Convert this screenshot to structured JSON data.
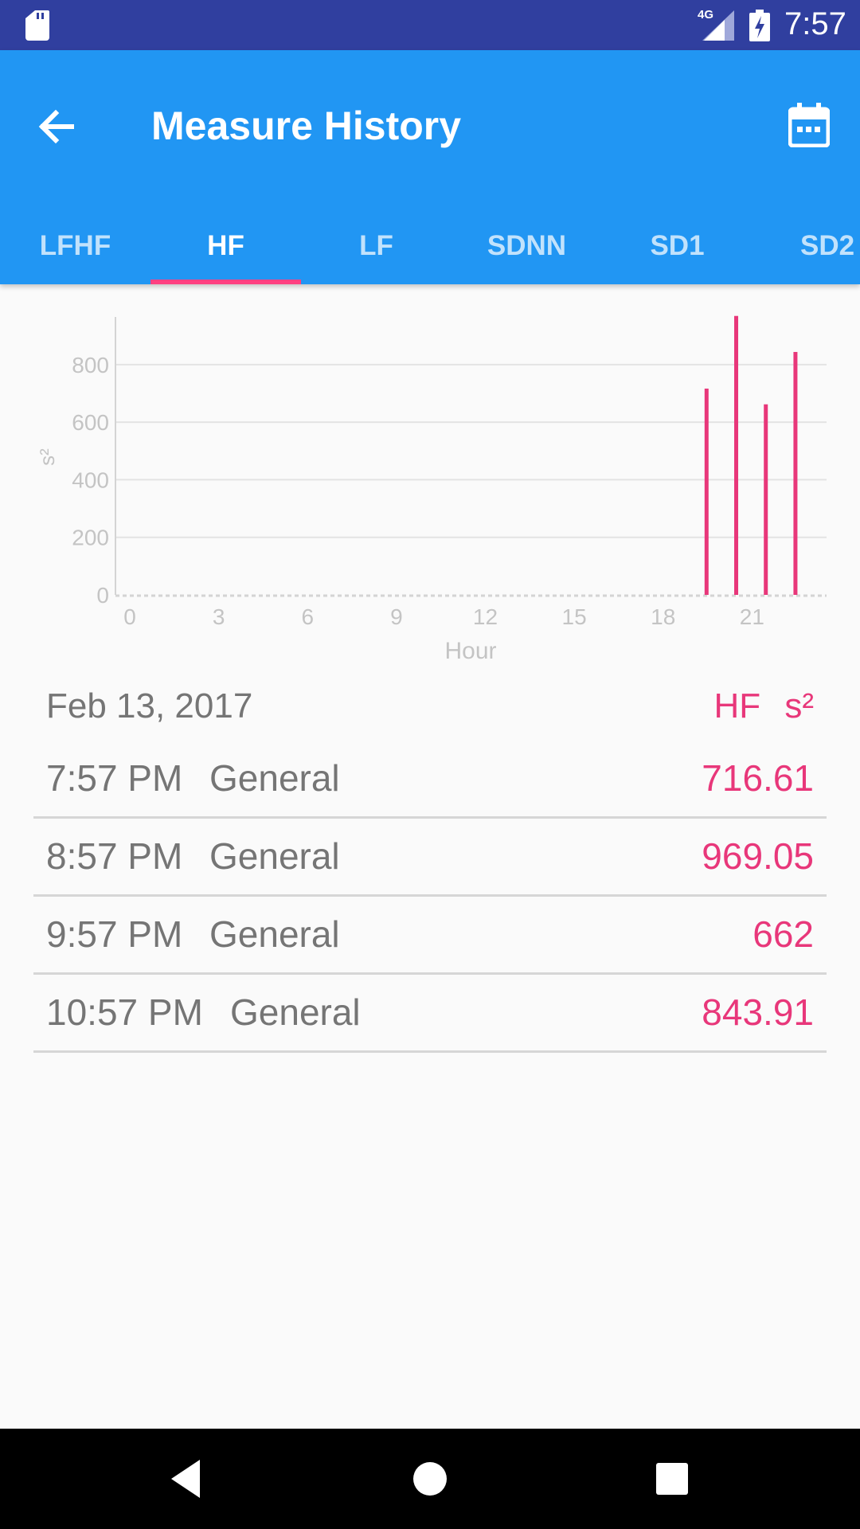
{
  "status_bar": {
    "time": "7:57",
    "network": "4G",
    "icons": [
      "sd-card-icon",
      "signal-icon",
      "battery-charging-icon"
    ]
  },
  "app_bar": {
    "title": "Measure History",
    "back_icon": "arrow-back-icon",
    "calendar_icon": "calendar-icon",
    "background": "#2196f3",
    "status_background": "#303f9f",
    "indicator_color": "#ff4081"
  },
  "tabs": [
    {
      "label": "LFHF",
      "active": false
    },
    {
      "label": "HF",
      "active": true
    },
    {
      "label": "LF",
      "active": false
    },
    {
      "label": "SDNN",
      "active": false
    },
    {
      "label": "SD1",
      "active": false
    },
    {
      "label": "SD2",
      "active": false
    }
  ],
  "chart_data": {
    "type": "bar",
    "ylabel": "s²",
    "xlabel": "Hour",
    "xlim": [
      0,
      24
    ],
    "ylim": [
      0,
      960
    ],
    "x_ticks": [
      0,
      3,
      6,
      9,
      12,
      15,
      18,
      21
    ],
    "y_ticks": [
      0,
      200,
      400,
      600,
      800
    ],
    "x": [
      19.95,
      20.95,
      21.95,
      22.95
    ],
    "values": [
      716.61,
      969.05,
      662,
      843.91
    ],
    "bar_color": "#e8377a",
    "grid": true
  },
  "summary": {
    "date": "Feb 13, 2017",
    "metric": "HF",
    "unit": "s²"
  },
  "measurements": [
    {
      "time": "7:57 PM",
      "type": "General",
      "value": "716.61"
    },
    {
      "time": "8:57 PM",
      "type": "General",
      "value": "969.05"
    },
    {
      "time": "9:57 PM",
      "type": "General",
      "value": "662"
    },
    {
      "time": "10:57 PM",
      "type": "General",
      "value": "843.91"
    }
  ],
  "nav_bar": {
    "icons": [
      "back-triangle-icon",
      "home-circle-icon",
      "recents-square-icon"
    ]
  }
}
